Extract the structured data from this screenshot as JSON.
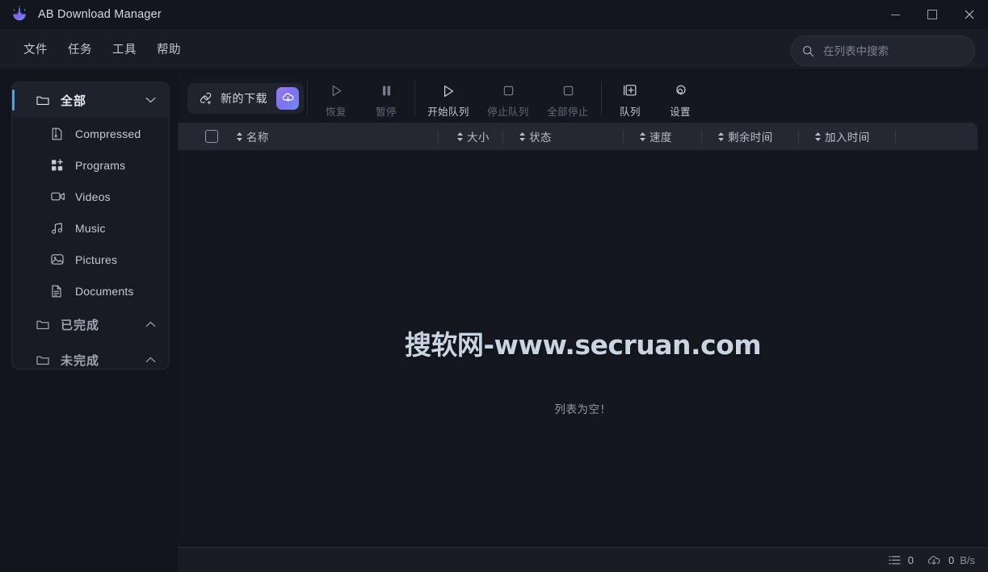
{
  "window": {
    "title": "AB Download Manager",
    "logo_icon": "download-cloud-logo",
    "controls": [
      {
        "name": "minimize-button",
        "icon": "minimize-icon"
      },
      {
        "name": "maximize-button",
        "icon": "maximize-icon"
      },
      {
        "name": "close-button",
        "icon": "close-icon"
      }
    ]
  },
  "menubar": {
    "items": [
      {
        "label": "文件",
        "name": "menu-file"
      },
      {
        "label": "任务",
        "name": "menu-tasks"
      },
      {
        "label": "工具",
        "name": "menu-tools"
      },
      {
        "label": "帮助",
        "name": "menu-help"
      }
    ]
  },
  "search": {
    "placeholder": "在列表中搜索",
    "value": "",
    "icon": "search-icon"
  },
  "sidebar": {
    "groups": [
      {
        "label": "全部",
        "icon": "folder-icon",
        "chevron": "chevron-down-icon",
        "active": true,
        "children": [
          {
            "label": "Compressed",
            "icon": "archive-icon"
          },
          {
            "label": "Programs",
            "icon": "apps-icon"
          },
          {
            "label": "Videos",
            "icon": "video-icon"
          },
          {
            "label": "Music",
            "icon": "music-icon"
          },
          {
            "label": "Pictures",
            "icon": "image-icon"
          },
          {
            "label": "Documents",
            "icon": "document-icon"
          }
        ]
      },
      {
        "label": "已完成",
        "icon": "folder-icon",
        "chevron": "chevron-up-icon",
        "active": false,
        "children": []
      },
      {
        "label": "未完成",
        "icon": "folder-icon",
        "chevron": "chevron-up-icon",
        "active": false,
        "children": []
      }
    ]
  },
  "toolbar": {
    "new_download": {
      "label": "新的下载",
      "link_icon": "link-plus-icon",
      "cloud_icon": "cloud-download-icon"
    },
    "actions": [
      {
        "label": "恢复",
        "icon": "play-icon",
        "name": "resume-button",
        "disabled": true
      },
      {
        "label": "暂停",
        "icon": "pause-icon",
        "name": "pause-button",
        "disabled": true
      },
      {
        "label": "开始队列",
        "icon": "play-icon",
        "name": "start-queue-button",
        "disabled": false
      },
      {
        "label": "停止队列",
        "icon": "stop-icon",
        "name": "stop-queue-button",
        "disabled": true
      },
      {
        "label": "全部停止",
        "icon": "stop-icon",
        "name": "stop-all-button",
        "disabled": true
      },
      {
        "label": "队列",
        "icon": "queue-icon",
        "name": "queue-button",
        "disabled": false
      },
      {
        "label": "设置",
        "icon": "gear-icon",
        "name": "settings-button",
        "disabled": false
      }
    ]
  },
  "table": {
    "select_all_checked": false,
    "columns": [
      {
        "label": "名称",
        "name": "column-name"
      },
      {
        "label": "大小",
        "name": "column-size"
      },
      {
        "label": "状态",
        "name": "column-status"
      },
      {
        "label": "速度",
        "name": "column-speed"
      },
      {
        "label": "剩余时间",
        "name": "column-remaining-time"
      },
      {
        "label": "加入时间",
        "name": "column-added-time"
      }
    ],
    "empty_message": "列表为空！",
    "rows": []
  },
  "watermark": {
    "text": "搜软网-www.secruan.com"
  },
  "statusbar": {
    "list_count": "0",
    "list_icon": "list-icon",
    "speed_value": "0",
    "speed_unit": "B/s",
    "speed_icon": "cloud-download-icon"
  },
  "colors": {
    "accent_blue": "#3da9f5",
    "accent_purple": "#7b72ee",
    "window_bg": "#14161e",
    "menu_bg": "#191c26",
    "panel_bg": "#15171f",
    "sidebar_bg": "#181b24",
    "table_header_bg": "#252833"
  }
}
